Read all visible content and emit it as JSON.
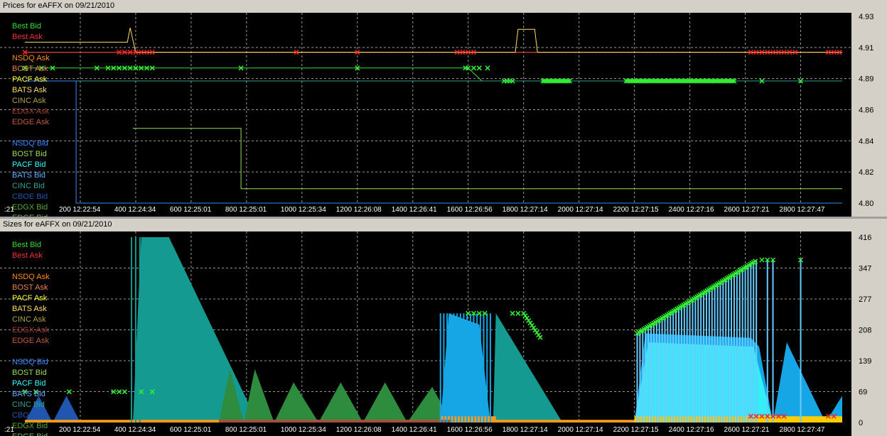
{
  "charts": {
    "top": {
      "title": "Prices for  eAFFX  on  09/21/2010",
      "x_ticks": [
        {
          "label": ":21",
          "x": 0
        },
        {
          "label": "200  12:22:54",
          "x": 200
        },
        {
          "label": "400  12:24:34",
          "x": 400
        },
        {
          "label": "600  12:25:01",
          "x": 600
        },
        {
          "label": "800  12:25:01",
          "x": 800
        },
        {
          "label": "1000  12:25:34",
          "x": 1000
        },
        {
          "label": "1200  12:26:08",
          "x": 1200
        },
        {
          "label": "1400  12:26:41",
          "x": 1400
        },
        {
          "label": "1600  12:26:56",
          "x": 1600
        },
        {
          "label": "1800  12:27:14",
          "x": 1800
        },
        {
          "label": "2000  12:27:14",
          "x": 2000
        },
        {
          "label": "2200  12:27:15",
          "x": 2200
        },
        {
          "label": "2400  12:27:16",
          "x": 2400
        },
        {
          "label": "2600  12:27:21",
          "x": 2600
        },
        {
          "label": "2800  12:27:47",
          "x": 2800
        }
      ],
      "y_ticks": [
        "4.93",
        "4.91",
        "4.89",
        "4.86",
        "4.84",
        "4.82",
        "4.80"
      ],
      "legend": [
        {
          "label": "Best Bid",
          "color": "#33dd33"
        },
        {
          "label": "Best Ask",
          "color": "#ee3333"
        },
        {
          "label": "",
          "color": "#000000"
        },
        {
          "label": "NSDQ Ask",
          "color": "#ff8c1a"
        },
        {
          "label": "BOST Ask",
          "color": "#e8824f"
        },
        {
          "label": "PACF Ask",
          "color": "#ffff33"
        },
        {
          "label": "BATS Ask",
          "color": "#ffe066"
        },
        {
          "label": "CINC Ask",
          "color": "#b0a040"
        },
        {
          "label": "EDGX Ask",
          "color": "#a04030"
        },
        {
          "label": "EDGE Ask",
          "color": "#c05a40"
        },
        {
          "label": "",
          "color": "#000000"
        },
        {
          "label": "NSDQ Bid",
          "color": "#3388ff"
        },
        {
          "label": "BOST Bid",
          "color": "#99dd55"
        },
        {
          "label": "PACF Bid",
          "color": "#33ffff"
        },
        {
          "label": "BATS Bid",
          "color": "#66aaff"
        },
        {
          "label": "CINC Bid",
          "color": "#30a090"
        },
        {
          "label": "CBOE Bid",
          "color": "#2255aa"
        },
        {
          "label": "EDGX Bid",
          "color": "#55aa33"
        },
        {
          "label": "EDGE Bid",
          "color": "#77bb55"
        }
      ]
    },
    "bottom": {
      "title": "Sizes for  eAFFX  on  09/21/2010",
      "y_ticks": [
        "416",
        "347",
        "277",
        "208",
        "139",
        "69",
        "0"
      ]
    }
  },
  "chart_data": [
    {
      "type": "line",
      "title": "Prices for  eAFFX  on  09/21/2010",
      "xlim": [
        0,
        2950
      ],
      "ylim": [
        4.8,
        4.93
      ],
      "series": [
        {
          "name": "NSDQ Ask",
          "color": "#ff8c1a",
          "points": [
            [
              0,
              4.905
            ],
            [
              2950,
              4.905
            ]
          ]
        },
        {
          "name": "Best Ask",
          "color": "#ee3333",
          "points": [
            [
              0,
              4.905
            ],
            [
              950,
              4.905
            ],
            [
              1600,
              4.905
            ],
            [
              1700,
              4.905
            ],
            [
              2600,
              4.905
            ],
            [
              2950,
              4.905
            ]
          ]
        },
        {
          "name": "Best Bid",
          "color": "#33dd33",
          "points": [
            [
              0,
              4.894
            ],
            [
              600,
              4.894
            ],
            [
              1000,
              4.894
            ],
            [
              1600,
              4.894
            ],
            [
              1650,
              4.885
            ],
            [
              2950,
              4.885
            ]
          ]
        },
        {
          "name": "BATS Ask",
          "color": "#ffe066",
          "points": [
            [
              0,
              4.912
            ],
            [
              370,
              4.912
            ],
            [
              380,
              4.922
            ],
            [
              400,
              4.905
            ],
            [
              1770,
              4.905
            ],
            [
              1780,
              4.921
            ],
            [
              1840,
              4.921
            ],
            [
              1850,
              4.905
            ],
            [
              2950,
              4.905
            ]
          ]
        },
        {
          "name": "CINC Bid",
          "color": "#30a090",
          "points": [
            [
              0,
              4.885
            ],
            [
              2950,
              4.885
            ]
          ]
        },
        {
          "name": "NSDQ Bid",
          "color": "#3388ff",
          "points": [
            [
              0,
              4.885
            ],
            [
              185,
              4.885
            ],
            [
              185,
              4.8
            ],
            [
              2950,
              4.8
            ]
          ]
        },
        {
          "name": "BOST Bid",
          "color": "#99dd55",
          "points": [
            [
              390,
              4.852
            ],
            [
              780,
              4.852
            ],
            [
              780,
              4.81
            ],
            [
              2950,
              4.81
            ]
          ]
        }
      ]
    },
    {
      "type": "area",
      "title": "Sizes for  eAFFX  on  09/21/2010",
      "xlim": [
        0,
        2950
      ],
      "ylim": [
        0,
        416
      ],
      "series": [
        {
          "name": "CINC Bid",
          "color": "#159a92",
          "points": [
            [
              0,
              0
            ],
            [
              390,
              0
            ],
            [
              420,
              416
            ],
            [
              520,
              416
            ],
            [
              840,
              0
            ],
            [
              1690,
              0
            ],
            [
              1700,
              245
            ],
            [
              1940,
              0
            ],
            [
              2950,
              0
            ]
          ]
        },
        {
          "name": "EDGX Bid",
          "color": "#2e8c3f",
          "points": [
            [
              700,
              0
            ],
            [
              740,
              120
            ],
            [
              790,
              0
            ],
            [
              830,
              120
            ],
            [
              900,
              0
            ],
            [
              970,
              90
            ],
            [
              1060,
              0
            ],
            [
              1140,
              90
            ],
            [
              1220,
              0
            ],
            [
              1300,
              90
            ],
            [
              1380,
              0
            ],
            [
              1470,
              80
            ],
            [
              1540,
              0
            ]
          ]
        },
        {
          "name": "BATS Bid",
          "color": "#16a6e6",
          "points": [
            [
              1500,
              0
            ],
            [
              1530,
              245
            ],
            [
              1640,
              220
            ],
            [
              1680,
              0
            ],
            [
              2200,
              0
            ],
            [
              2240,
              200
            ],
            [
              2620,
              190
            ],
            [
              2650,
              170
            ],
            [
              2700,
              0
            ],
            [
              2750,
              180
            ],
            [
              2890,
              0
            ],
            [
              2950,
              60
            ]
          ]
        },
        {
          "name": "PACF Bid",
          "color": "#33eef6",
          "points": [
            [
              2200,
              0
            ],
            [
              2250,
              180
            ],
            [
              2630,
              170
            ],
            [
              2700,
              0
            ]
          ]
        },
        {
          "name": "CBOE Bid",
          "color": "#1e56b0",
          "points": [
            [
              0,
              0
            ],
            [
              50,
              60
            ],
            [
              100,
              0
            ],
            [
              150,
              60
            ],
            [
              200,
              0
            ]
          ]
        },
        {
          "name": "NSDQ Ask",
          "color": "#ff9a1a",
          "points": [
            [
              0,
              0
            ],
            [
              2950,
              0
            ]
          ]
        }
      ]
    }
  ]
}
